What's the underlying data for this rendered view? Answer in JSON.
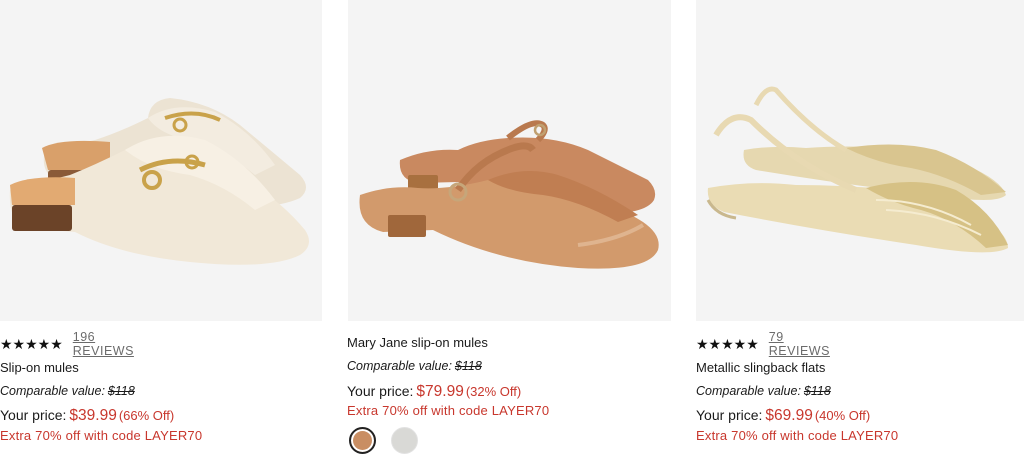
{
  "products": [
    {
      "stars": "★★★★★",
      "reviews": "196 REVIEWS",
      "name": "Slip-on mules",
      "comparable_label": "Comparable value:",
      "comparable_price": "$118",
      "price_label": "Your price:",
      "price": "$39.99",
      "discount": "(66% Off)",
      "promo": "Extra 70% off with code LAYER70",
      "image_icon": "mule-shoe-image"
    },
    {
      "name": "Mary Jane slip-on mules",
      "comparable_label": "Comparable value:",
      "comparable_price": "$118",
      "price_label": "Your price:",
      "price": "$79.99",
      "discount": "(32% Off)",
      "promo": "Extra 70% off with code LAYER70",
      "image_icon": "mary-jane-mule-image",
      "swatches": [
        {
          "color": "#c98e63",
          "selected": true
        },
        {
          "color": "#d9d9d6",
          "selected": false
        }
      ]
    },
    {
      "stars": "★★★★★",
      "reviews": "79 REVIEWS",
      "name": "Metallic slingback flats",
      "comparable_label": "Comparable value:",
      "comparable_price": "$118",
      "price_label": "Your price:",
      "price": "$69.99",
      "discount": "(40% Off)",
      "promo": "Extra 70% off with code LAYER70",
      "image_icon": "slingback-flat-image"
    }
  ],
  "colors": {
    "sale_red": "#c8372d",
    "image_bg": "#f4f4f4"
  }
}
